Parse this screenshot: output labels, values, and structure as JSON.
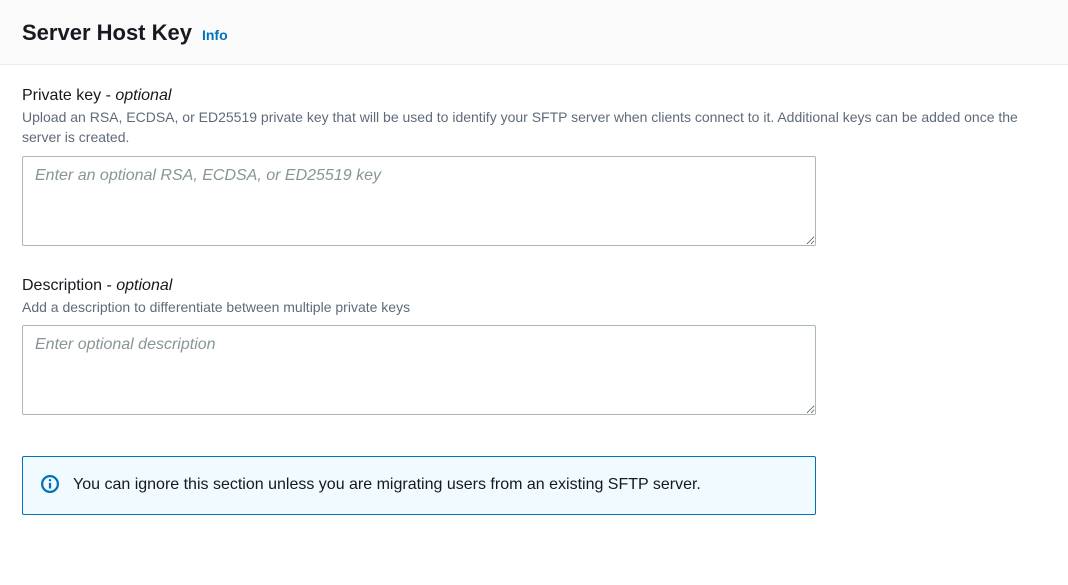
{
  "header": {
    "title": "Server Host Key",
    "info_link": "Info"
  },
  "private_key": {
    "label_main": "Private key - ",
    "label_optional": "optional",
    "help": "Upload an RSA, ECDSA, or ED25519 private key that will be used to identify your SFTP server when clients connect to it. Additional keys can be added once the server is created.",
    "placeholder": "Enter an optional RSA, ECDSA, or ED25519 key",
    "value": ""
  },
  "description": {
    "label_main": "Description - ",
    "label_optional": "optional",
    "help": "Add a description to differentiate between multiple private keys",
    "placeholder": "Enter optional description",
    "value": ""
  },
  "notice": {
    "text": "You can ignore this section unless you are migrating users from an existing SFTP server."
  }
}
